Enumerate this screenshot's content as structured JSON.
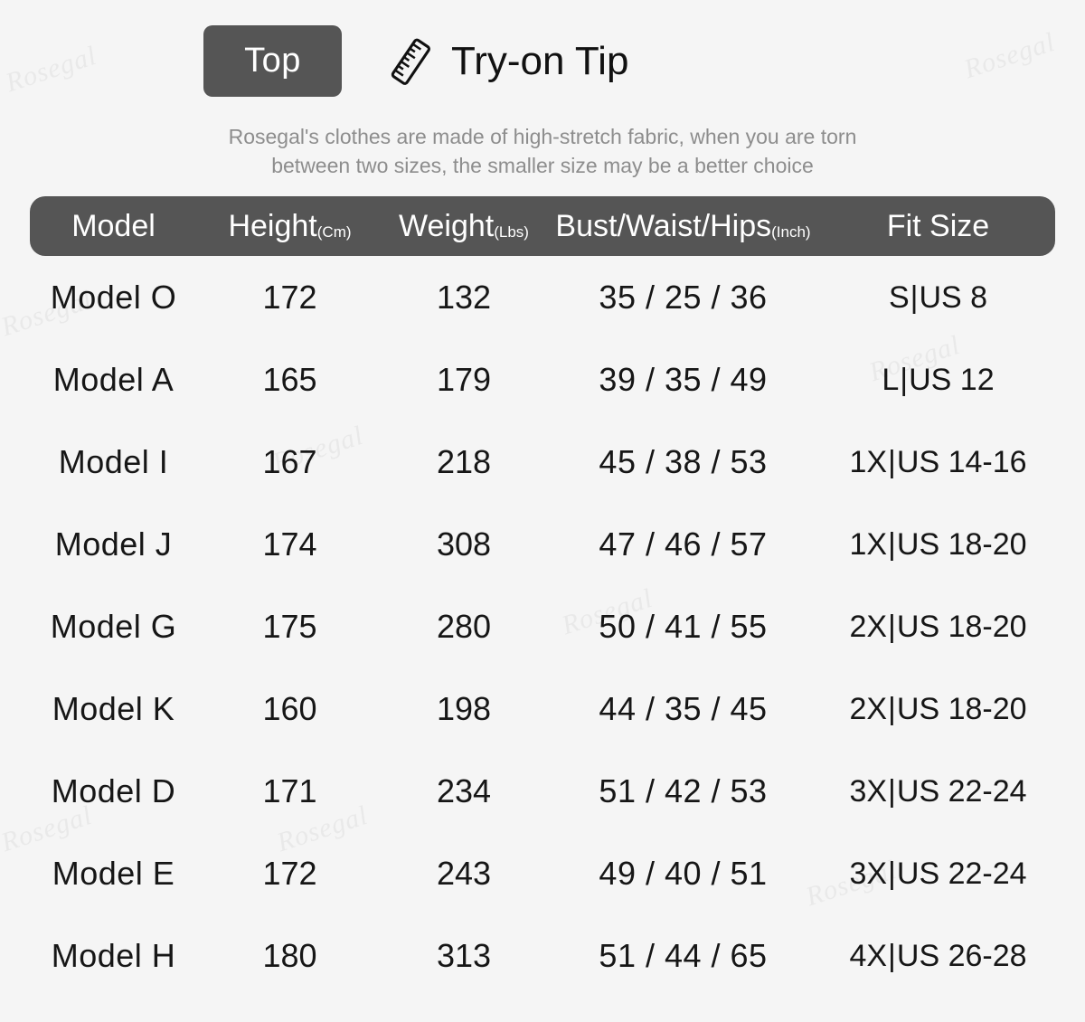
{
  "background_color": "#f5f5f5",
  "accent_color": "#555555",
  "header_text_color": "#ffffff",
  "subtitle_color": "#8d8d8d",
  "body_text_color": "#161616",
  "watermark": {
    "text": "Rosegal",
    "color": "#e6e6e6"
  },
  "header": {
    "badge_label": "Top",
    "ruler_icon": "ruler-icon",
    "tip_title": "Try-on Tip"
  },
  "subtitle": {
    "line1": "Rosegal's clothes are made of high-stretch fabric, when you are torn",
    "line2": "between two sizes, the smaller size may be a better choice"
  },
  "table": {
    "columns": [
      {
        "label": "Model",
        "unit": ""
      },
      {
        "label": "Height",
        "unit": "(Cm)"
      },
      {
        "label": "Weight",
        "unit": "(Lbs)"
      },
      {
        "label": "Bust/Waist/Hips",
        "unit": "(Inch)"
      },
      {
        "label": "Fit Size",
        "unit": ""
      }
    ],
    "rows": [
      {
        "model": "Model O",
        "height": "172",
        "weight": "132",
        "bwh": "35 / 25 / 36",
        "fit_size_prefix": "S",
        "fit_size_suffix": "US 8"
      },
      {
        "model": "Model A",
        "height": "165",
        "weight": "179",
        "bwh": "39 / 35 / 49",
        "fit_size_prefix": "L",
        "fit_size_suffix": "US 12"
      },
      {
        "model": "Model I",
        "height": "167",
        "weight": "218",
        "bwh": "45 / 38 / 53",
        "fit_size_prefix": "1X",
        "fit_size_suffix": "US 14-16"
      },
      {
        "model": "Model J",
        "height": "174",
        "weight": "308",
        "bwh": "47 / 46 / 57",
        "fit_size_prefix": "1X",
        "fit_size_suffix": "US 18-20"
      },
      {
        "model": "Model G",
        "height": "175",
        "weight": "280",
        "bwh": "50 / 41 / 55",
        "fit_size_prefix": "2X",
        "fit_size_suffix": "US 18-20"
      },
      {
        "model": "Model K",
        "height": "160",
        "weight": "198",
        "bwh": "44 / 35 / 45",
        "fit_size_prefix": "2X",
        "fit_size_suffix": "US 18-20"
      },
      {
        "model": "Model D",
        "height": "171",
        "weight": "234",
        "bwh": "51 / 42 / 53",
        "fit_size_prefix": "3X",
        "fit_size_suffix": "US 22-24"
      },
      {
        "model": "Model E",
        "height": "172",
        "weight": "243",
        "bwh": "49 / 40 / 51",
        "fit_size_prefix": "3X",
        "fit_size_suffix": "US 22-24"
      },
      {
        "model": "Model H",
        "height": "180",
        "weight": "313",
        "bwh": "51 / 44 / 65",
        "fit_size_prefix": "4X",
        "fit_size_suffix": "US 26-28"
      }
    ]
  }
}
